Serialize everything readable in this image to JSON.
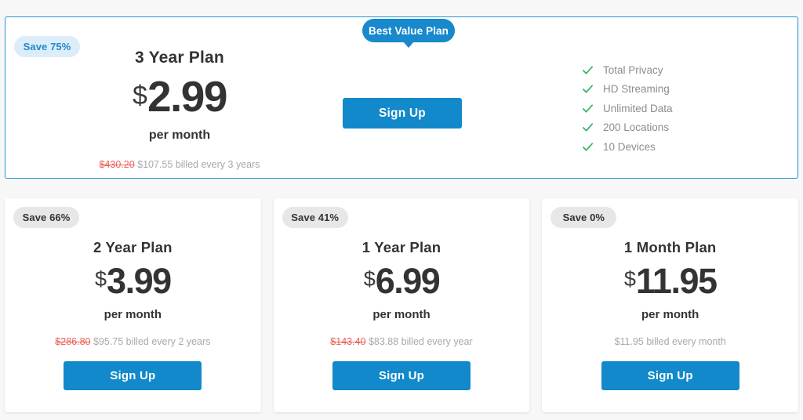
{
  "featured_plan": {
    "badge_label": "Best Value Plan",
    "save_label": "Save 75%",
    "title": "3 Year Plan",
    "currency": "$",
    "amount": "2.99",
    "period": "per month",
    "old_price": "$430.20",
    "billing_text": "$107.55 billed every 3 years",
    "signup_label": "Sign Up",
    "features": [
      {
        "label": "Total Privacy",
        "icon": "check-icon"
      },
      {
        "label": "HD Streaming",
        "icon": "check-icon"
      },
      {
        "label": "Unlimited Data",
        "icon": "check-icon"
      },
      {
        "label": "200 Locations",
        "icon": "check-icon"
      },
      {
        "label": "10 Devices",
        "icon": "check-icon"
      }
    ]
  },
  "plans": [
    {
      "save_label": "Save 66%",
      "title": "2 Year Plan",
      "currency": "$",
      "amount": "3.99",
      "period": "per month",
      "old_price": "$286.80",
      "billing_text": "$95.75 billed every 2 years",
      "signup_label": "Sign Up"
    },
    {
      "save_label": "Save 41%",
      "title": "1 Year Plan",
      "currency": "$",
      "amount": "6.99",
      "period": "per month",
      "old_price": "$143.40",
      "billing_text": "$83.88 billed every year",
      "signup_label": "Sign Up"
    },
    {
      "save_label": "Save 0%",
      "title": "1 Month Plan",
      "currency": "$",
      "amount": "11.95",
      "period": "per month",
      "old_price": "",
      "billing_text": "$11.95 billed every month",
      "signup_label": "Sign Up"
    }
  ],
  "colors": {
    "accent_blue": "#1289ca",
    "badge_blue": "#1789cc",
    "featured_border": "#2196d6",
    "save_badge_blue_bg": "#dcedf9",
    "save_badge_gray_bg": "#e7e7e7",
    "check_green": "#36b36b",
    "old_price_red": "#e8625a",
    "muted_gray": "#a8a8a8",
    "page_bg": "#f7f7f7"
  }
}
